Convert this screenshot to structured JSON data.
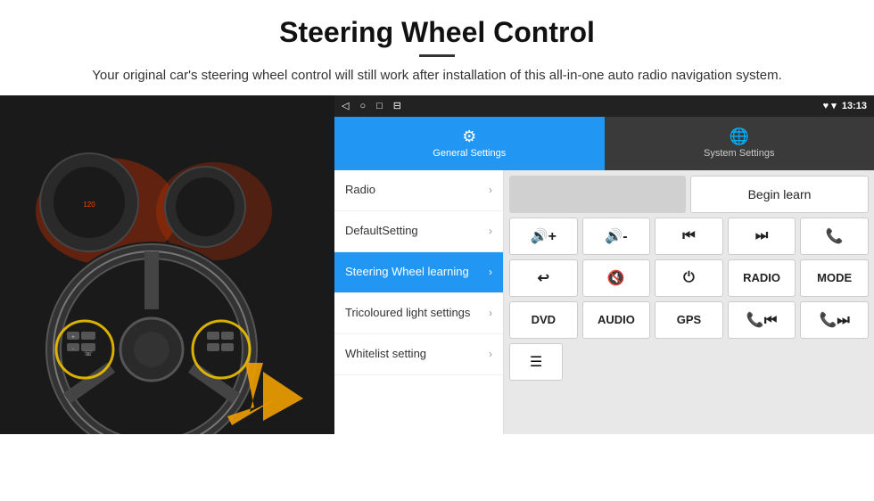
{
  "header": {
    "title": "Steering Wheel Control",
    "subtitle": "Your original car's steering wheel control will still work after installation of this all-in-one auto radio navigation system."
  },
  "statusBar": {
    "navIcons": [
      "◁",
      "○",
      "□",
      "⊟"
    ],
    "rightIcons": "♥ ▾ 13:13"
  },
  "settingsTabs": [
    {
      "label": "General Settings",
      "icon": "⚙",
      "active": true
    },
    {
      "label": "System Settings",
      "icon": "🌐",
      "active": false
    }
  ],
  "menuItems": [
    {
      "label": "Radio",
      "active": false
    },
    {
      "label": "DefaultSetting",
      "active": false
    },
    {
      "label": "Steering Wheel learning",
      "active": true
    },
    {
      "label": "Tricoloured light settings",
      "active": false
    },
    {
      "label": "Whitelist setting",
      "active": false
    }
  ],
  "controls": {
    "beginLearnLabel": "Begin learn",
    "row1": [
      "🔊+",
      "🔊-",
      "⏮",
      "⏭",
      "📞"
    ],
    "row1Labels": [
      "vol+",
      "vol-",
      "prev",
      "next",
      "phone"
    ],
    "row2Labels": [
      "hangup",
      "mute",
      "power",
      "RADIO",
      "MODE"
    ],
    "row2Icons": [
      "↩",
      "🔊✕",
      "⏻",
      "RADIO",
      "MODE"
    ],
    "row3Labels": [
      "DVD",
      "AUDIO",
      "GPS",
      "tel+prev",
      "tel+next"
    ]
  }
}
